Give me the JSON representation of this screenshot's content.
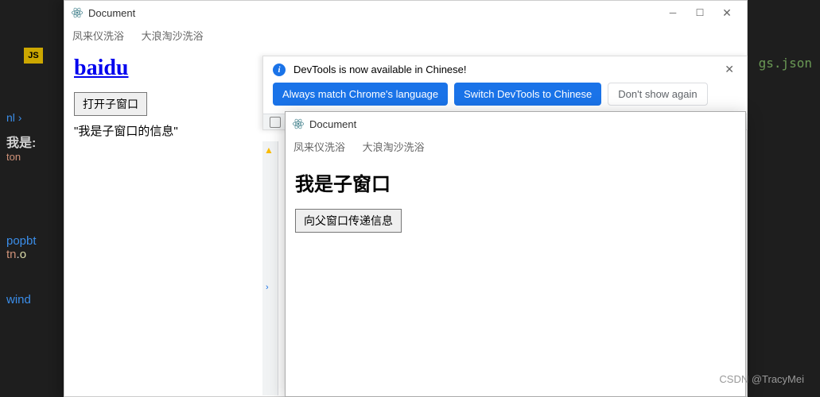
{
  "background": {
    "js_badge": "JS",
    "breadcrumb_suffix": "nl ›",
    "text1": "我是:",
    "text2": "ton",
    "text3": "popbt",
    "text4": "tn.o",
    "text5": "wind",
    "right_file": "gs.json"
  },
  "main_window": {
    "title": "Document",
    "menu_item1": "凤来仪洗浴",
    "menu_item2": "大浪淘沙洗浴",
    "link_label": "baidu",
    "open_button": "打开子窗口",
    "message": "\"我是子窗口的信息\""
  },
  "devtools_banner": {
    "info_text": "DevTools is now available in Chinese!",
    "btn_match": "Always match Chrome's language",
    "btn_switch": "Switch DevTools to Chinese",
    "btn_dismiss": "Don't show again"
  },
  "child_window": {
    "title": "Document",
    "menu_item1": "凤来仪洗浴",
    "menu_item2": "大浪淘沙洗浴",
    "heading": "我是子窗口",
    "send_button": "向父窗口传递信息"
  },
  "watermark": "CSDN @TracyMei"
}
